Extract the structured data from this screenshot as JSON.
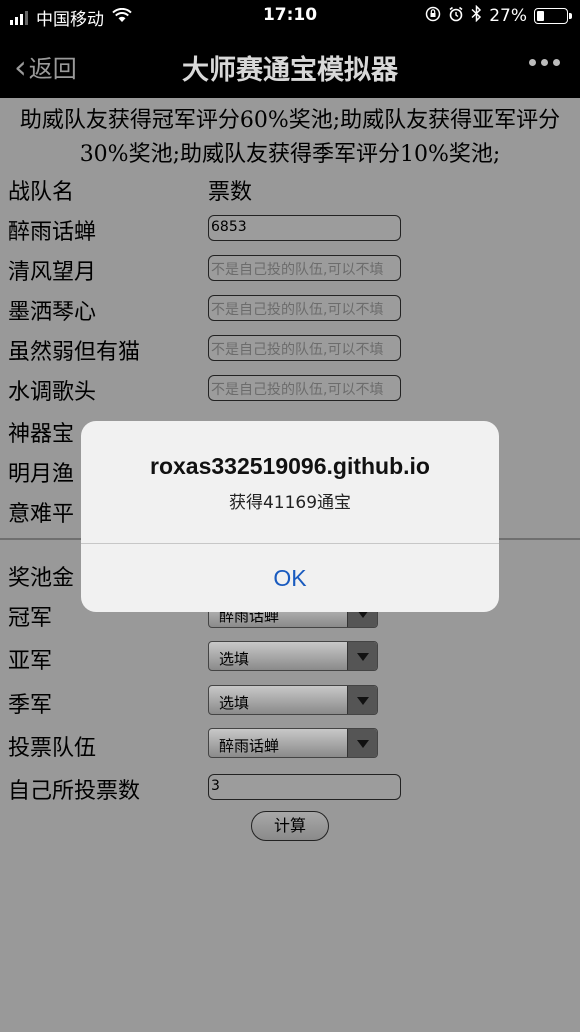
{
  "status_bar": {
    "carrier": "中国移动",
    "time": "17:10",
    "battery_text": "27%",
    "battery_level": 0.27
  },
  "nav": {
    "back_label": "返回",
    "title": "大师赛通宝模拟器"
  },
  "notice": "助威队友获得冠军评分60%奖池;助威队友获得亚军评分30%奖池;助威队友获得季军评分10%奖池;",
  "table_header": {
    "team": "战队名",
    "votes": "票数"
  },
  "teams": [
    {
      "name": "醉雨话蝉",
      "value": "6853",
      "placeholder": ""
    },
    {
      "name": "清风望月",
      "value": "",
      "placeholder": "不是自己投的队伍,可以不填"
    },
    {
      "name": "墨洒琴心",
      "value": "",
      "placeholder": "不是自己投的队伍,可以不填"
    },
    {
      "name": "虽然弱但有猫",
      "value": "",
      "placeholder": "不是自己投的队伍,可以不填"
    },
    {
      "name": "水调歌头",
      "value": "",
      "placeholder": "不是自己投的队伍,可以不填"
    },
    {
      "name": "神器宝",
      "value": "",
      "placeholder": ""
    },
    {
      "name": "明月渔",
      "value": "",
      "placeholder": ""
    },
    {
      "name": "意难平",
      "value": "",
      "placeholder": ""
    }
  ],
  "bottom": {
    "prize_label": "奖池金",
    "champion_label": "冠军",
    "champion_value": "醉雨话蝉",
    "runner_up_label": "亚军",
    "runner_up_value": "选填",
    "third_label": "季军",
    "third_value": "选填",
    "vote_team_label": "投票队伍",
    "vote_team_value": "醉雨话蝉",
    "own_votes_label": "自己所投票数",
    "own_votes_value": "3",
    "calc_label": "计算"
  },
  "alert": {
    "title": "roxas332519096.github.io",
    "message": "获得41169通宝",
    "ok_label": "OK"
  }
}
